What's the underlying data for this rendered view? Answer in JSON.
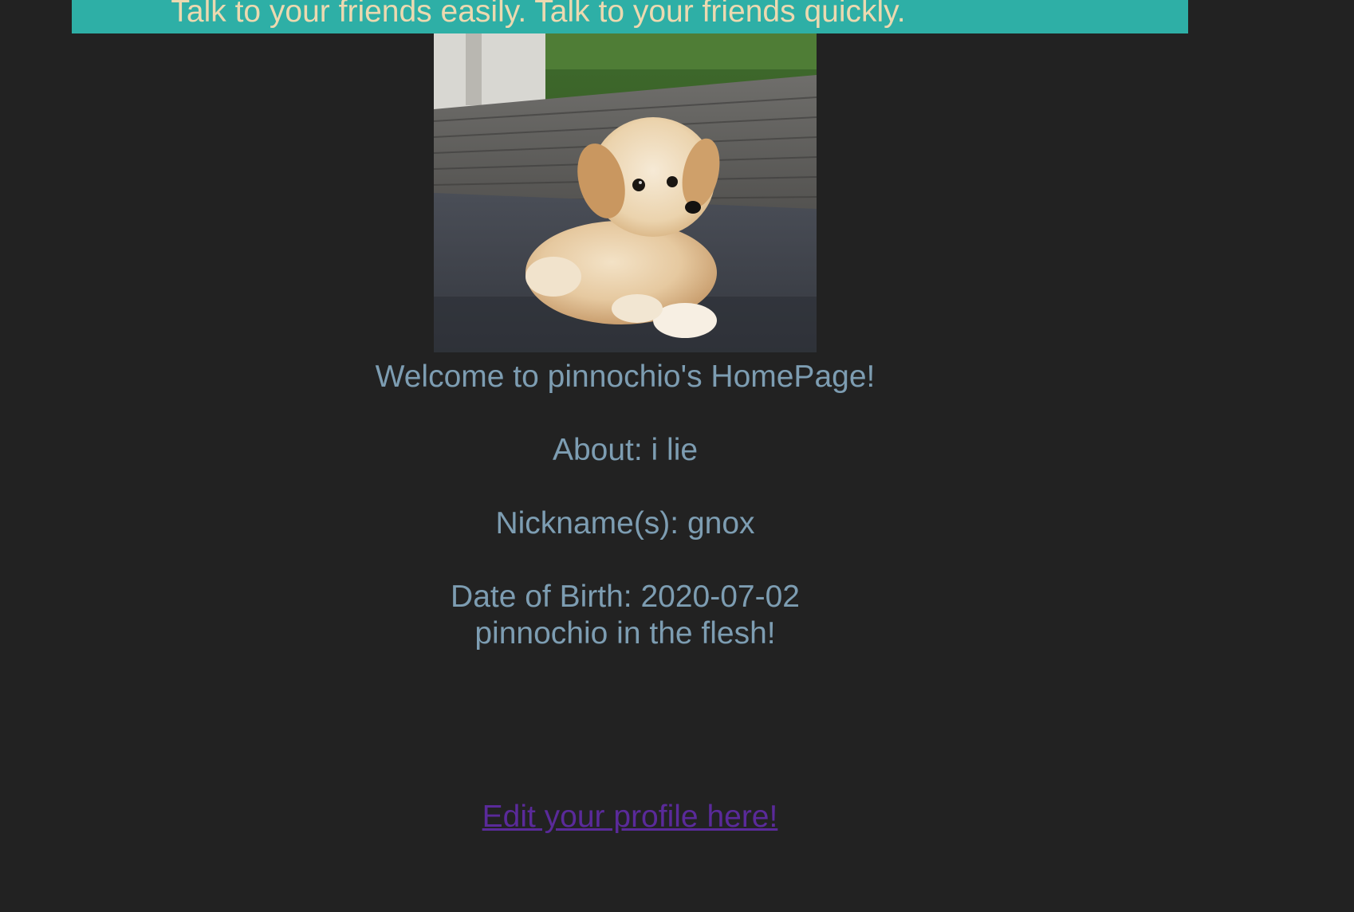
{
  "banner": {
    "text": "Talk to your friends easily. Talk to your friends quickly.",
    "background_color": "#2eafa6",
    "text_color": "#ecd9b0"
  },
  "profile": {
    "photo_icon": "puppy-photo",
    "welcome": "Welcome to pinnochio's HomePage!",
    "about": "About: i lie",
    "nicknames": "Nickname(s): gnox",
    "dob": "Date of Birth: 2020-07-02",
    "tagline": "pinnochio in the flesh!",
    "text_color": "#7d9db2"
  },
  "edit_link": {
    "label": "Edit your profile here!",
    "color": "#5a2a9a"
  }
}
